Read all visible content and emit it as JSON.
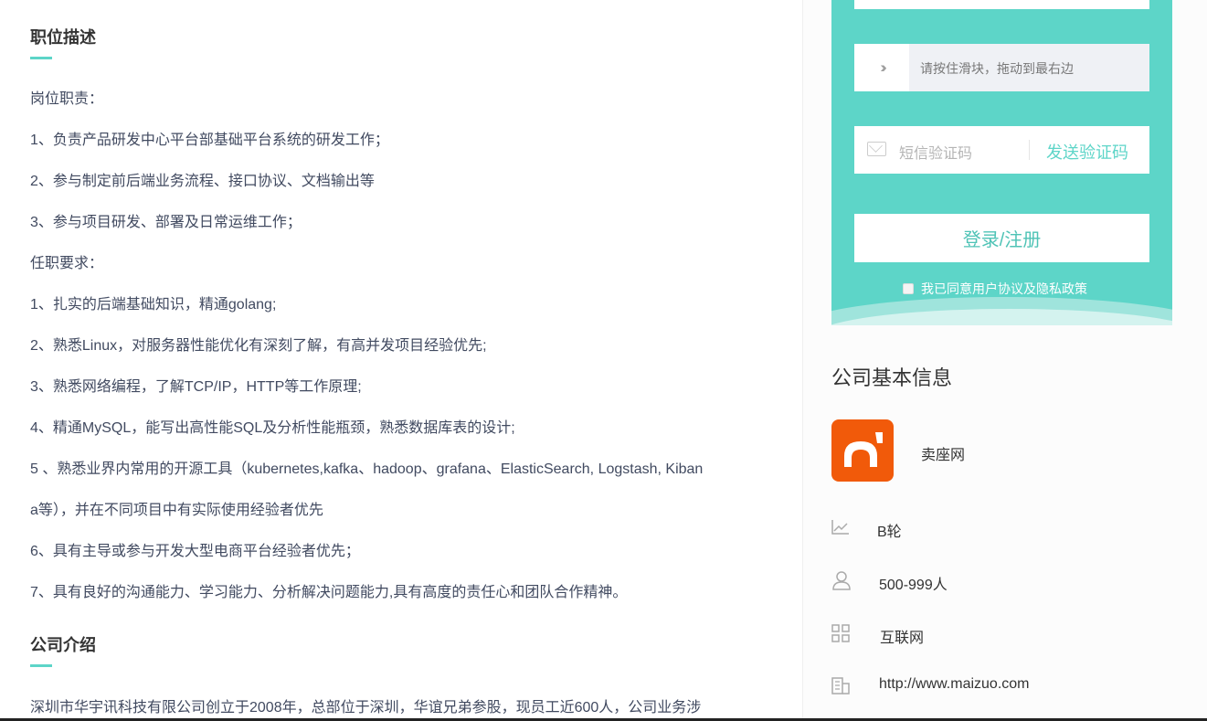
{
  "job_description": {
    "title": "职位描述",
    "lines": [
      "岗位职责：",
      "1、负责产品研发中心平台部基础平台系统的研发工作；",
      "2、参与制定前后端业务流程、接口协议、文档输出等",
      "3、参与项目研发、部署及日常运维工作；",
      "任职要求：",
      "1、扎实的后端基础知识，精通golang;",
      "2、熟悉Linux，对服务器性能优化有深刻了解，有高并发项目经验优先;",
      "3、熟悉网络编程，了解TCP/IP，HTTP等工作原理;",
      "4、精通MySQL，能写出高性能SQL及分析性能瓶颈，熟悉数据库表的设计;",
      "5 、熟悉业界内常用的开源工具（kubernetes,kafka、hadoop、grafana、ElasticSearch, Logstash, Kiban",
      "a等），并在不同项目中有实际使用经验者优先",
      "6、具有主导或参与开发大型电商平台经验者优先；",
      "7、具有良好的沟通能力、学习能力、分析解决问题能力,具有高度的责任心和团队合作精神。"
    ]
  },
  "company_intro": {
    "title": "公司介绍",
    "text": "深圳市华宇讯科技有限公司创立于2008年，总部位于深圳，华谊兄弟参股，现员工近600人，公司业务涉"
  },
  "login": {
    "slider_icon": "double-chevron-right",
    "slider_text": "请按住滑块，拖动到最右边",
    "sms_placeholder": "短信验证码",
    "send_code": "发送验证码",
    "login_button": "登录/注册",
    "agree_text": "我已同意用户协议及隐私政策"
  },
  "company_info": {
    "title": "公司基本信息",
    "name": "卖座网",
    "items": [
      {
        "icon": "chart-line-icon",
        "text": "B轮"
      },
      {
        "icon": "user-icon",
        "text": "500-999人"
      },
      {
        "icon": "grid-icon",
        "text": "互联网"
      },
      {
        "icon": "building-icon",
        "text": "http://www.maizuo.com"
      }
    ]
  },
  "colors": {
    "accent": "#5dd5c8",
    "logo": "#f15a0a",
    "text": "#414a60"
  }
}
